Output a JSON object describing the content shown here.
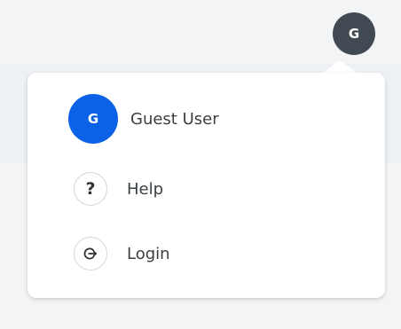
{
  "header": {
    "avatar_initial": "G"
  },
  "menu": {
    "user": {
      "avatar_initial": "G",
      "name": "Guest User",
      "avatar_color": "#0b62e6"
    },
    "items": [
      {
        "label": "Help",
        "icon": "help-icon"
      },
      {
        "label": "Login",
        "icon": "login-icon"
      }
    ]
  },
  "colors": {
    "top_avatar_bg": "#414a52",
    "user_avatar_bg": "#0b62e6",
    "icon_border": "#cfd8e0",
    "text": "#3a3f44"
  }
}
